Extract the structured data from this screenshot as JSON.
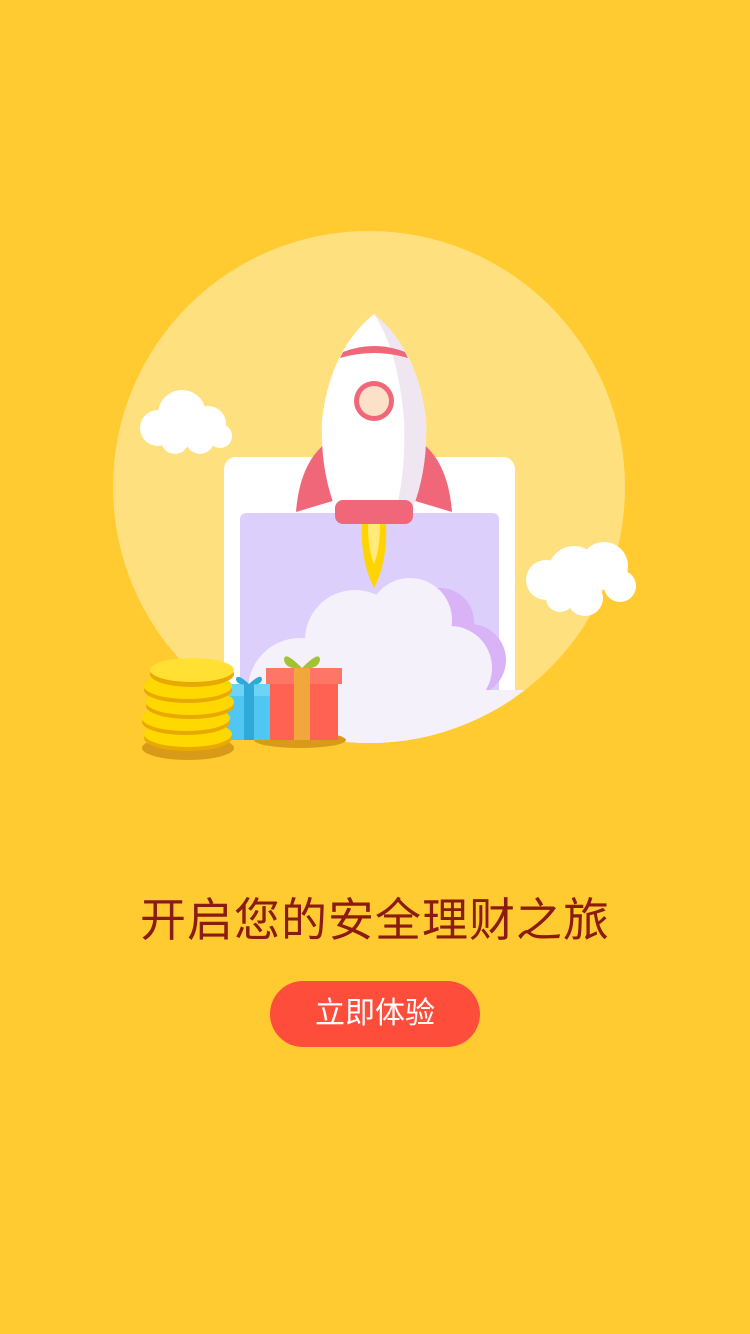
{
  "colors": {
    "background": "#FFCB30",
    "headline": "#8B1A10",
    "button": "#FF4D3C",
    "button_text": "#FFFFFF"
  },
  "hero": {
    "illustration": [
      "sun-circle-icon",
      "cloud-icon",
      "tablet-icon",
      "rocket-icon",
      "coin-stack-icon",
      "gift-box-icon"
    ]
  },
  "main": {
    "headline": "开启您的安全理财之旅",
    "cta_label": "立即体验"
  }
}
